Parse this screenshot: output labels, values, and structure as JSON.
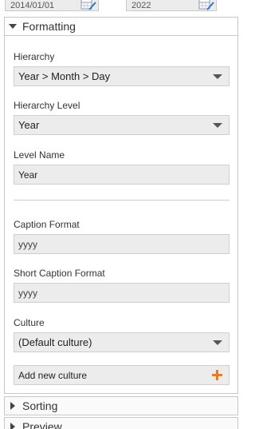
{
  "dates": {
    "start_value": "2014/01/01",
    "end_value": "2022"
  },
  "sections": {
    "formatting": {
      "label": "Formatting",
      "expanded": true
    },
    "sorting": {
      "label": "Sorting",
      "expanded": false
    },
    "preview": {
      "label": "Preview",
      "expanded": false
    }
  },
  "formatting": {
    "hierarchy": {
      "label": "Hierarchy",
      "value": "Year > Month > Day"
    },
    "hierarchy_level": {
      "label": "Hierarchy Level",
      "value": "Year"
    },
    "level_name": {
      "label": "Level Name",
      "value": "Year"
    },
    "caption_format": {
      "label": "Caption Format",
      "value": "yyyy"
    },
    "short_caption_format": {
      "label": "Short Caption Format",
      "value": "yyyy"
    },
    "culture": {
      "label": "Culture",
      "value": "(Default culture)"
    },
    "add_culture_label": "Add new culture"
  },
  "colors": {
    "accent": "#f0781e"
  }
}
